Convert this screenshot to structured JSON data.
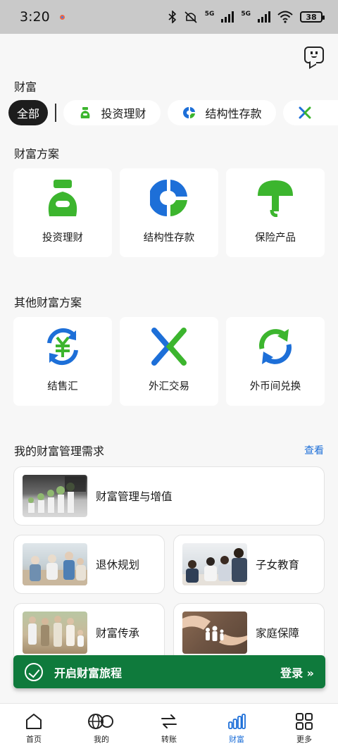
{
  "status_bar": {
    "time": "3:20",
    "network_1": "5G",
    "network_2": "5G",
    "battery": "38"
  },
  "header": {
    "section_title": "财富"
  },
  "chips": [
    {
      "label": "全部"
    },
    {
      "label": "投资理财"
    },
    {
      "label": "结构性存款"
    }
  ],
  "solutions": {
    "title": "财富方案",
    "items": [
      {
        "label": "投资理财"
      },
      {
        "label": "结构性存款"
      },
      {
        "label": "保险产品"
      }
    ]
  },
  "other_solutions": {
    "title": "其他财富方案",
    "items": [
      {
        "label": "结售汇"
      },
      {
        "label": "外汇交易"
      },
      {
        "label": "外币间兑换"
      }
    ]
  },
  "needs": {
    "title": "我的财富管理需求",
    "see_all": "查看",
    "items": [
      {
        "label": "财富管理与增值"
      },
      {
        "label": "退休规划"
      },
      {
        "label": "子女教育"
      },
      {
        "label": "财富传承"
      },
      {
        "label": "家庭保障"
      }
    ]
  },
  "banner": {
    "text": "开启财富旅程",
    "login": "登录 »"
  },
  "tabs": [
    {
      "label": "首页"
    },
    {
      "label": "我的"
    },
    {
      "label": "转账"
    },
    {
      "label": "财富"
    },
    {
      "label": "更多"
    }
  ],
  "colors": {
    "green": "#3cb52e",
    "blue": "#1d6fd8",
    "banner": "#0f7a3c"
  }
}
